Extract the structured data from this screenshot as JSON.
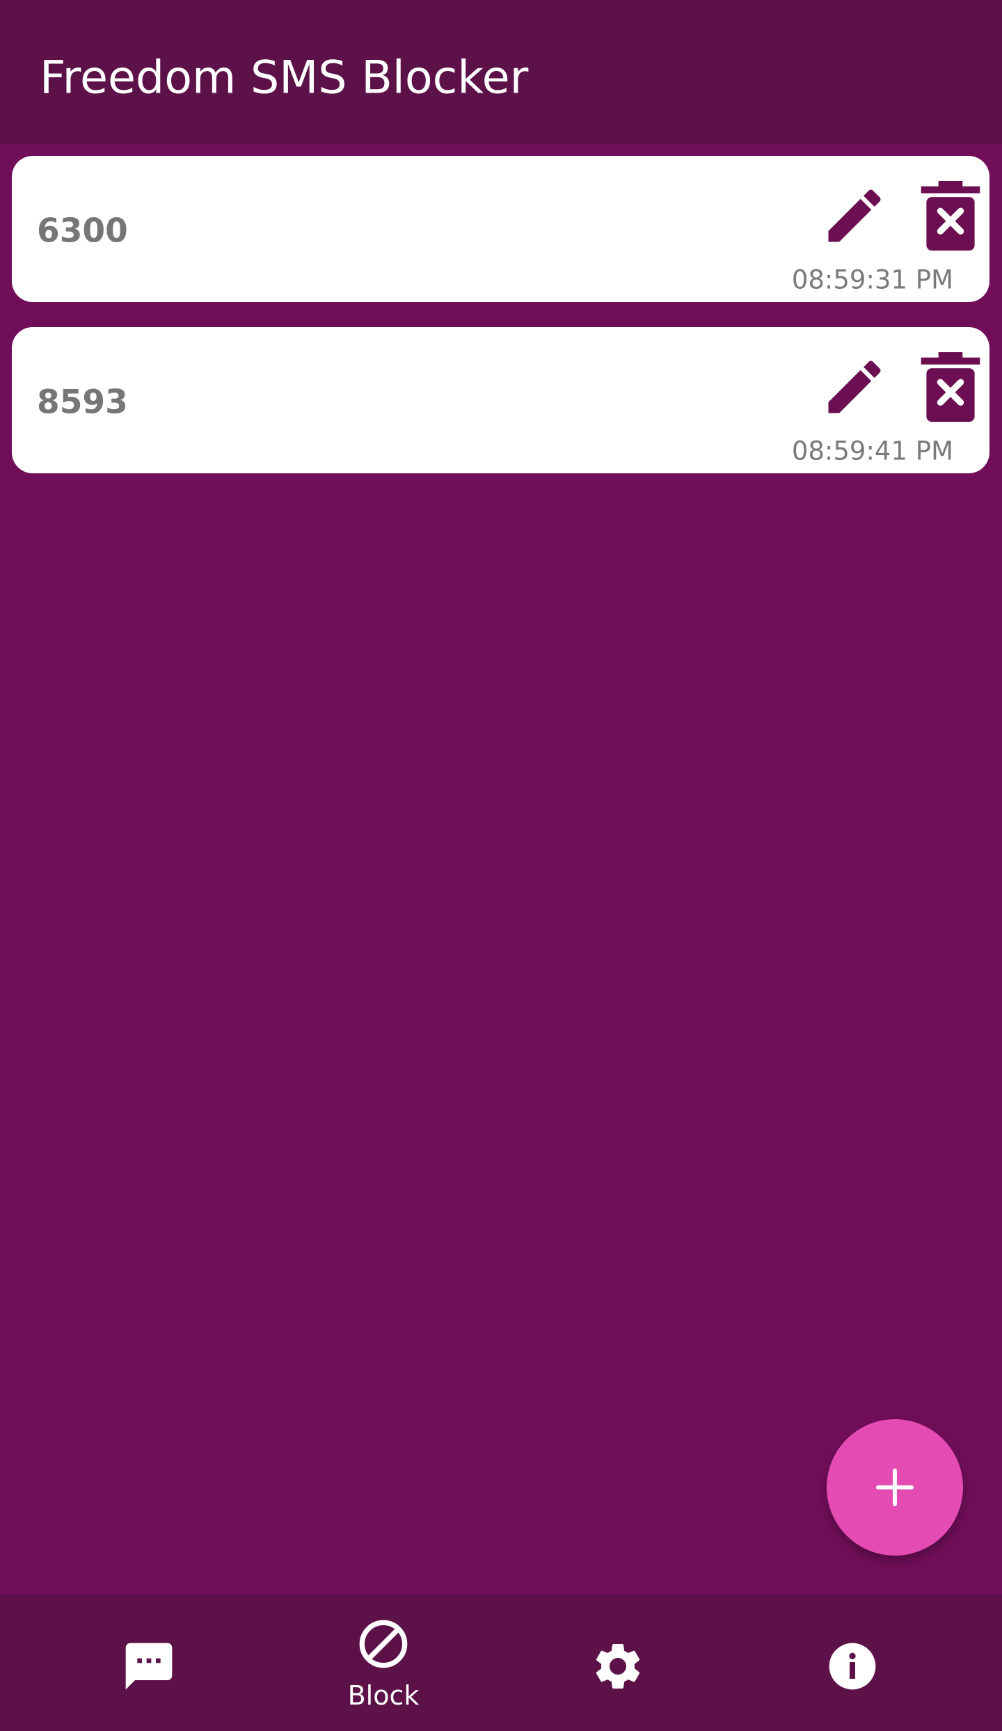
{
  "app_bar": {
    "title": "Freedom SMS Blocker"
  },
  "blocked_list": [
    {
      "number": "6300",
      "time": "08:59:31 PM"
    },
    {
      "number": "8593",
      "time": "08:59:41 PM"
    }
  ],
  "icons": {
    "edit": "pencil-icon",
    "delete": "trash-x-icon",
    "fab": "plus-icon",
    "nav_messages": "message-dots-icon",
    "nav_block": "block-icon",
    "nav_settings": "gear-icon",
    "nav_info": "info-icon"
  },
  "bottom_nav": {
    "selected": "block",
    "block_label": "Block"
  },
  "colors": {
    "background": "#710e5a",
    "bars": "#5c1149",
    "card": "#ffffff",
    "fab": "#e44bb3",
    "icon_accent": "#6b0f52"
  }
}
